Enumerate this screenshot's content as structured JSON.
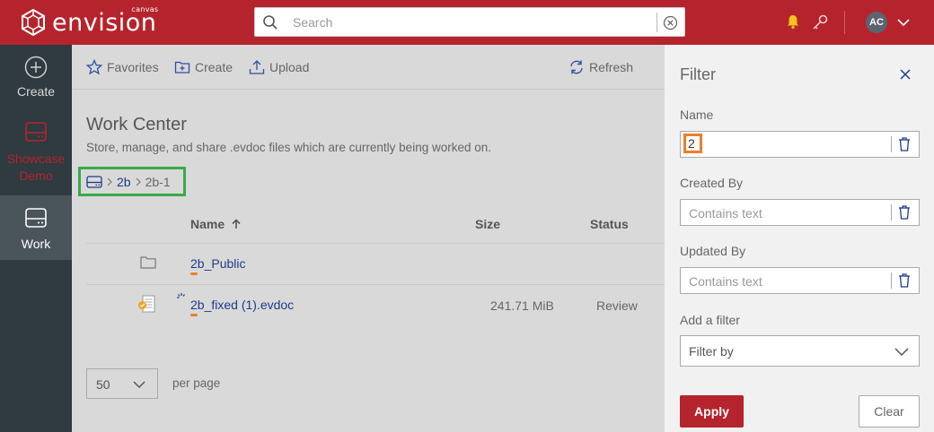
{
  "app": {
    "brand": "envision",
    "brand_sub": "canvas"
  },
  "search": {
    "placeholder": "Search",
    "value": ""
  },
  "user": {
    "initials": "AC"
  },
  "nav": {
    "create": "Create",
    "showcase": "Showcase Demo",
    "work": "Work"
  },
  "toolbar": {
    "favorites": "Favorites",
    "create": "Create",
    "upload": "Upload",
    "refresh": "Refresh"
  },
  "page": {
    "title": "Work Center",
    "description": "Store, manage, and share .evdoc files which are currently being worked on."
  },
  "breadcrumb": {
    "items": [
      "2b",
      "2b-1"
    ]
  },
  "table": {
    "headers": {
      "name": "Name",
      "size": "Size",
      "status": "Status"
    },
    "rows": [
      {
        "name": "2b_Public",
        "size": "",
        "status": "",
        "type": "folder"
      },
      {
        "name": "2b_fixed (1).evdoc",
        "size": "241.71 MiB",
        "status": "Review",
        "type": "evdoc"
      }
    ]
  },
  "pager": {
    "value": "50",
    "label": "per page"
  },
  "filter": {
    "title": "Filter",
    "name_label": "Name",
    "name_value": "2",
    "created_by_label": "Created By",
    "created_by_placeholder": "Contains text",
    "updated_by_label": "Updated By",
    "updated_by_placeholder": "Contains text",
    "add_filter_label": "Add a filter",
    "add_filter_value": "Filter by",
    "apply": "Apply",
    "clear": "Clear"
  },
  "colors": {
    "brand": "#b5242c",
    "nav_bg": "#2f3a41",
    "link": "#1f3a8a",
    "highlight_orange": "#f07c2a",
    "highlight_green": "#3aa94a"
  }
}
